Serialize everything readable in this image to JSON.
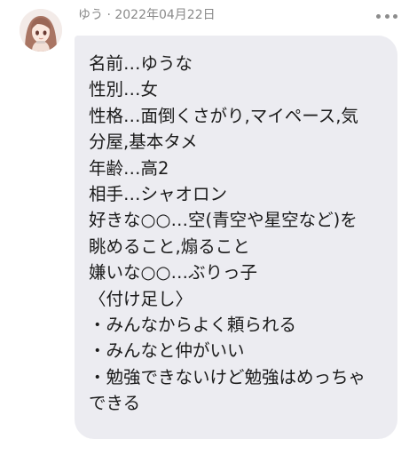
{
  "post": {
    "author": "ゆう",
    "separator": " · ",
    "date": "2022年04月22日",
    "message_lines": [
      "名前…ゆうな",
      "性別…女",
      "性格…面倒くさがり,マイペース,気",
      "分屋,基本タメ",
      "年齢…高2",
      "相手…シャオロン",
      "好きな○○…空(青空や星空など)を",
      "眺めること,煽ること",
      "嫌いな○○…ぶりっ子",
      "〈付け足し〉",
      "・みんなからよく頼られる",
      "・みんなと仲がいい",
      "・勉強できないけど勉強はめっちゃ",
      "できる"
    ]
  },
  "icons": {
    "avatar": "anime-girl-avatar",
    "more": "more-horizontal-icon"
  },
  "colors": {
    "bubble": "#ececf1",
    "meta_text": "#8a8a8a",
    "message_text": "#1b1b1b"
  }
}
